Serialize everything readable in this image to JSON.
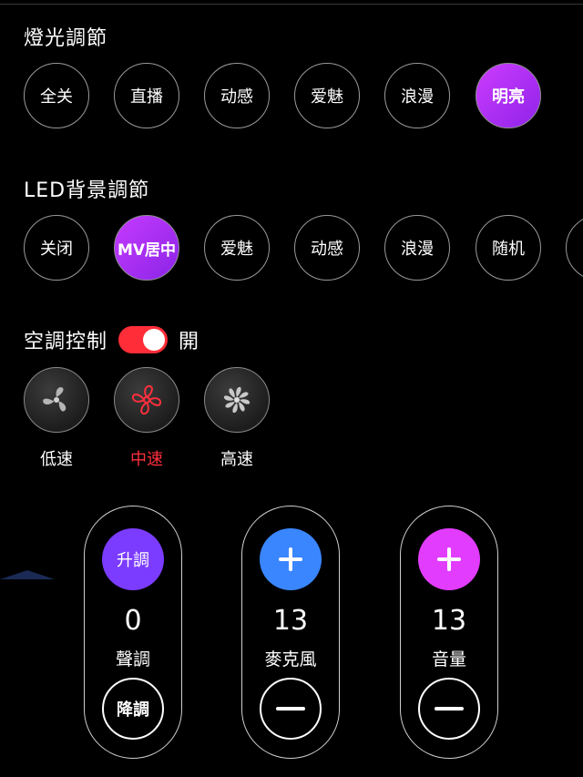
{
  "lighting": {
    "title": "燈光調節",
    "items": [
      "全关",
      "直播",
      "动感",
      "爱魅",
      "浪漫",
      "明亮"
    ],
    "active_index": 5
  },
  "led": {
    "title": "LED背景調節",
    "items": [
      "关闭",
      "MV居中",
      "爱魅",
      "动感",
      "浪漫",
      "随机"
    ],
    "active_index": 1
  },
  "ac": {
    "title": "空調控制",
    "state": "開",
    "toggle_on": true,
    "accent_color": "#ff2d37",
    "speeds": [
      {
        "label": "低速",
        "icon": "fan-low-icon"
      },
      {
        "label": "中速",
        "icon": "fan-medium-icon"
      },
      {
        "label": "高速",
        "icon": "fan-high-icon"
      }
    ],
    "selected_speed_index": 1
  },
  "controls": [
    {
      "top_label": "升調",
      "top_color": "#7b3cff",
      "value": "0",
      "label": "聲調",
      "bottom_label": "降調"
    },
    {
      "top_label": "",
      "top_color": "#3a86ff",
      "value": "13",
      "label": "麥克風",
      "bottom_label": ""
    },
    {
      "top_label": "",
      "top_color": "#e23cff",
      "value": "13",
      "label": "音量",
      "bottom_label": ""
    }
  ]
}
